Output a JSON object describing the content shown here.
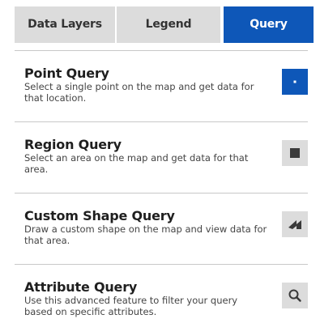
{
  "tabs": [
    {
      "label": "Data Layers",
      "active": false
    },
    {
      "label": "Legend",
      "active": false
    },
    {
      "label": "Query",
      "active": true
    }
  ],
  "queries": [
    {
      "title": "Point Query",
      "description": "Select a single point on the map and get data for that location.",
      "icon": "point-icon",
      "active": true
    },
    {
      "title": "Region Query",
      "description": "Select an area on the map and get data for that area.",
      "icon": "square-icon",
      "active": false
    },
    {
      "title": "Custom Shape Query",
      "description": "Draw a custom shape on the map and view data for that area.",
      "icon": "polygon-icon",
      "active": false
    },
    {
      "title": "Attribute Query",
      "description": "Use this advanced feature to filter your query based on specific attributes.",
      "icon": "search-icon",
      "active": false
    }
  ],
  "colors": {
    "accent": "#0e57b8",
    "inactive": "#dcdcdc",
    "icon_dark": "#3a3a3a",
    "divider": "#c8c8c8"
  }
}
